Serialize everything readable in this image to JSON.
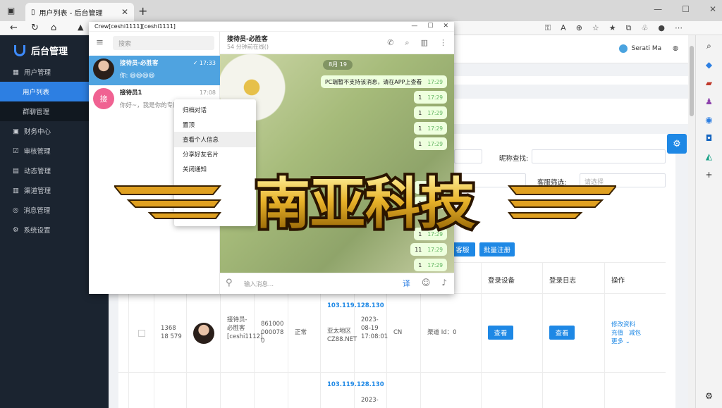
{
  "browser": {
    "tab_title": "用户列表 - 后台管理",
    "new_tab": "+",
    "window_controls": [
      "—",
      "☐",
      "✕"
    ]
  },
  "sidebar": {
    "brand": "后台管理",
    "items": [
      {
        "label": "用户管理",
        "icon": "▦"
      },
      {
        "label": "用户列表",
        "icon": ""
      },
      {
        "label": "群聊管理",
        "icon": ""
      },
      {
        "label": "财务中心",
        "icon": "▣"
      },
      {
        "label": "审核管理",
        "icon": "☑"
      },
      {
        "label": "动态管理",
        "icon": "▤"
      },
      {
        "label": "渠道管理",
        "icon": "▥"
      },
      {
        "label": "消息管理",
        "icon": "◎"
      },
      {
        "label": "系统设置",
        "icon": "⚙"
      }
    ]
  },
  "header": {
    "user_name": "Serati Ma"
  },
  "filters": {
    "nickname_label": "昵称查找:",
    "cs_label": "客服筛选:",
    "cs_placeholder": "请选择",
    "batch_register": "批量注册",
    "cs_button": "客服"
  },
  "table": {
    "headers": {
      "device": "登录设备",
      "log": "登录日志",
      "ops": "操作"
    },
    "row1": {
      "id": "1368 18 579",
      "nickname": "接待员-必胜客 [ceshi1112]",
      "phone": "861000 000078 0",
      "status": "正常",
      "ip": "103.119.128.130",
      "location": "亚太地区 CZ88.NET",
      "time": "2023-08-19 17:08:01",
      "country": "CN",
      "channel": "渠道 Id：0",
      "view1": "查看",
      "view2": "查看",
      "op_edit": "修改资料",
      "op_recharge": "充值",
      "op_deduct": "减包",
      "op_more": "更多 ⌄"
    },
    "row2": {
      "ip": "103.119.128.130",
      "time": "2023-"
    }
  },
  "chat": {
    "window_title": "Crew[ceshi1111][ceshi1111]",
    "search_placeholder": "搜索",
    "conversations": [
      {
        "name": "接待员-必胜客",
        "msg": "你: 😄😄😄😄",
        "time": "✓ 17:33"
      },
      {
        "name": "接待员1",
        "msg": "你好~，我是你的专属",
        "time": "17:08",
        "initial": "接"
      }
    ],
    "header_name": "接待员-必胜客",
    "header_status": "54 分钟前在线()",
    "date": "8月 19",
    "first_msg": "PC端暂不支持该消息，请在APP上查看",
    "msg_time": "17:29",
    "bubbles": [
      "1",
      "1",
      "1",
      "1",
      "1",
      "1",
      "1",
      "1",
      "1",
      "1",
      "11",
      "1"
    ],
    "input_placeholder": "输入消息...",
    "translate_icon": "译"
  },
  "context_menu": [
    "归档对话",
    "置顶",
    "查看个人信息",
    "分享好友名片",
    "关闭通知"
  ],
  "watermark": "南亚科技"
}
